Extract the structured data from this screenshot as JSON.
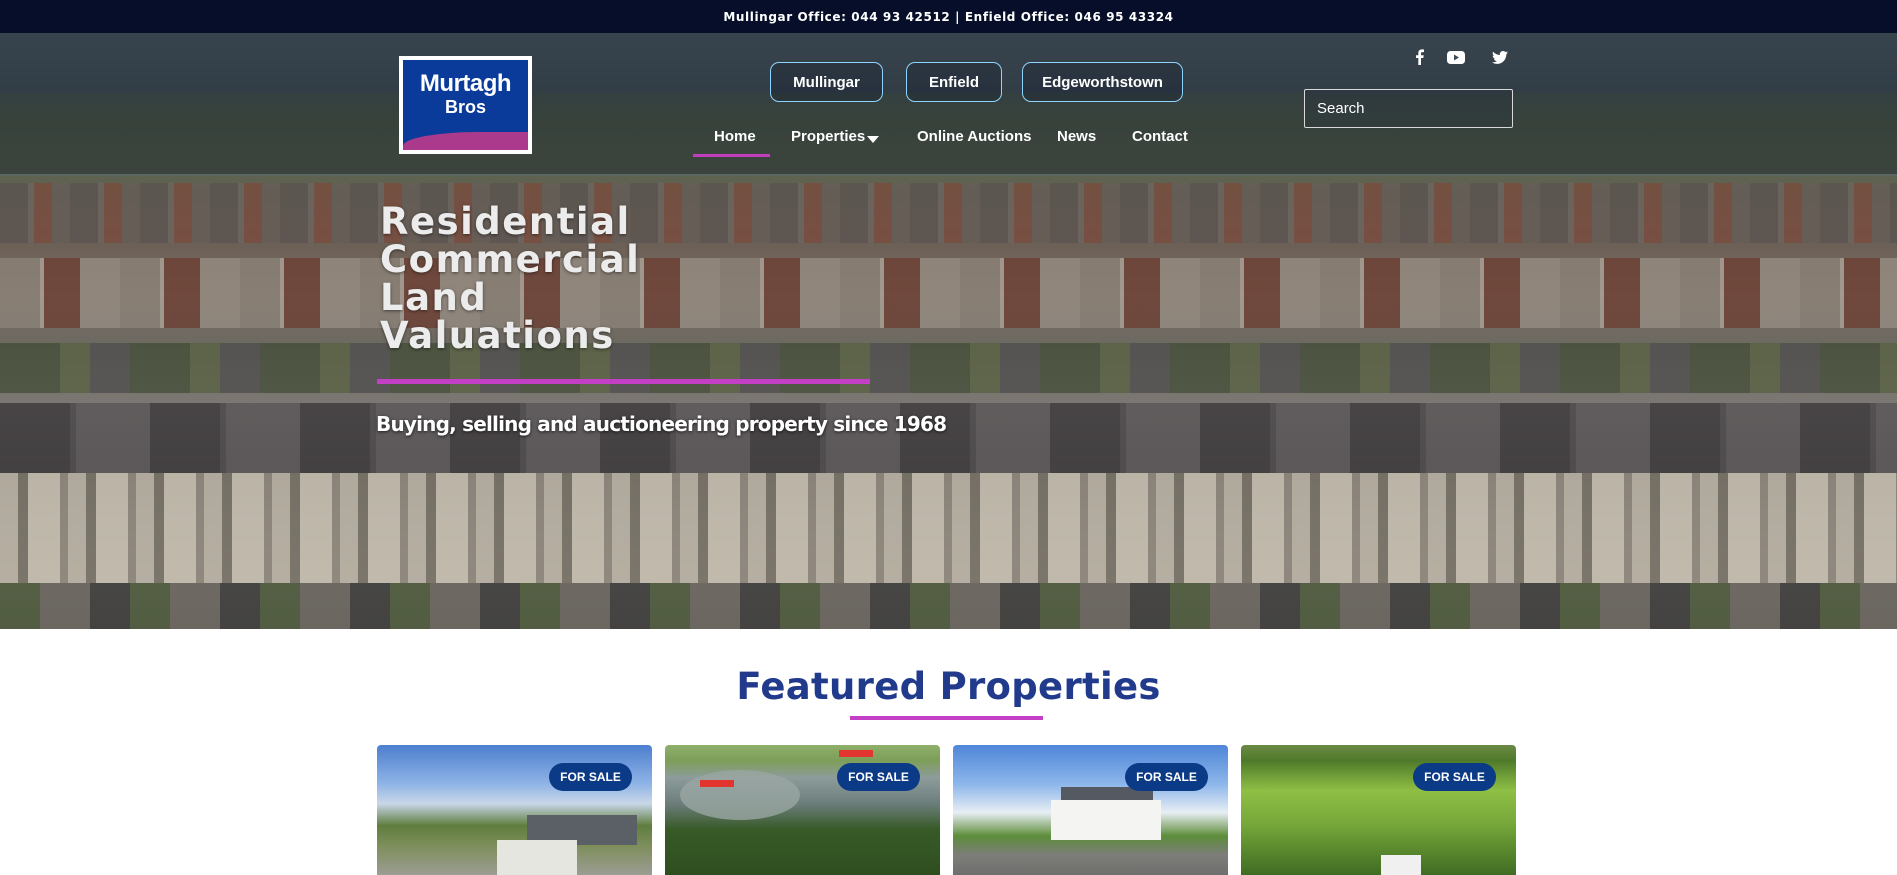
{
  "topbar": {
    "text": "Mullingar Office: 044 93 42512 | Enfield Office: 046 95 43324"
  },
  "logo": {
    "line1": "Murtagh",
    "line2": "Bros"
  },
  "offices": [
    {
      "label": "Mullingar"
    },
    {
      "label": "Enfield"
    },
    {
      "label": "Edgeworthstown"
    }
  ],
  "nav": {
    "items": [
      {
        "label": "Home",
        "active": true
      },
      {
        "label": "Properties",
        "has_dropdown": true
      },
      {
        "label": "Online Auctions"
      },
      {
        "label": "News"
      },
      {
        "label": "Contact"
      }
    ]
  },
  "social": {
    "icons": [
      "facebook-icon",
      "youtube-icon",
      "twitter-icon"
    ]
  },
  "search": {
    "placeholder": "Search",
    "value": ""
  },
  "hero": {
    "lines": [
      "Residential",
      "Commercial",
      "Land",
      "Valuations"
    ],
    "tagline": "Buying, selling and auctioneering property since 1968"
  },
  "featured": {
    "title": "Featured Properties",
    "cards": [
      {
        "badge": "FOR SALE"
      },
      {
        "badge": "FOR SALE"
      },
      {
        "badge": "FOR SALE"
      },
      {
        "badge": "FOR SALE"
      }
    ]
  },
  "colors": {
    "topbar_bg": "#060e2a",
    "accent_magenta": "#c33fc6",
    "brand_blue": "#213a8c",
    "badge_blue": "#0b3a86",
    "office_button_border": "#8fd3ff"
  }
}
